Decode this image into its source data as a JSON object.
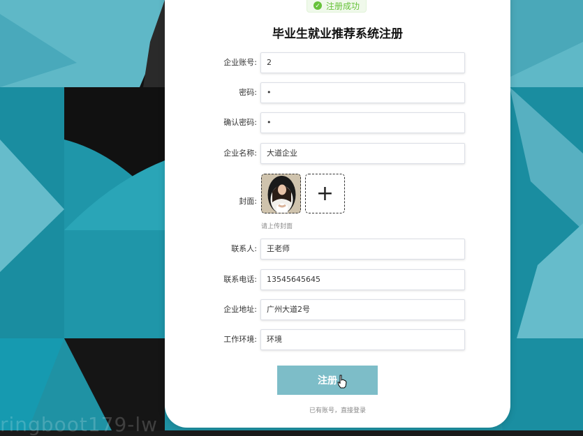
{
  "toast": {
    "text": "注册成功",
    "icon": "check-circle-icon",
    "color": "#67c23a"
  },
  "title": "毕业生就业推荐系统注册",
  "form": {
    "account_label": "企业账号:",
    "account_value": "2",
    "password_label": "密码:",
    "password_value": "•",
    "confirm_label": "确认密码:",
    "confirm_value": "•",
    "company_label": "企业名称:",
    "company_value": "大道企业",
    "cover_label": "封面:",
    "cover_hint": "请上传封面",
    "contact_label": "联系人:",
    "contact_value": "王老师",
    "phone_label": "联系电话:",
    "phone_value": "13545645645",
    "address_label": "企业地址:",
    "address_value": "广州大道2号",
    "env_label": "工作环境:",
    "env_value": "环境"
  },
  "submit_label": "注册",
  "login_link": "已有账号，直接登录",
  "watermark": "ringboot179-lw",
  "colors": {
    "accent": "#7dbdc8",
    "teal": "#1b8fa2",
    "dark": "#1b1b1b"
  }
}
